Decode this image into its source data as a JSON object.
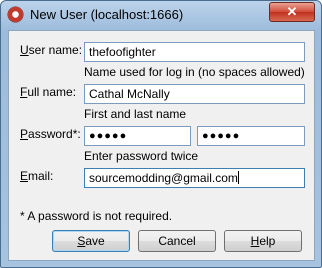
{
  "window": {
    "title": "New User (localhost:1666)",
    "close_glyph": "✕"
  },
  "form": {
    "user_name": {
      "label": "User name:",
      "mnemonic": "U",
      "label_rest": "ser name:",
      "value": "thefoofighter",
      "hint": "Name used for log in (no spaces allowed)"
    },
    "full_name": {
      "label": "Full name:",
      "mnemonic": "F",
      "label_rest": "ull name:",
      "value": "Cathal McNally",
      "hint": "First and last name"
    },
    "password": {
      "label": "Password*:",
      "mnemonic": "P",
      "label_rest": "assword*:",
      "value_masked": "●●●●●",
      "confirm_masked": "●●●●●",
      "hint": "Enter password twice"
    },
    "email": {
      "label": "Email:",
      "mnemonic": "E",
      "label_rest": "mail:",
      "value": "sourcemodding@gmail.com"
    },
    "note": "* A password is not required."
  },
  "buttons": {
    "save": {
      "mnemonic": "S",
      "rest": "ave"
    },
    "cancel": {
      "label": "Cancel"
    },
    "help": {
      "mnemonic": "H",
      "rest": "elp"
    }
  },
  "icons": {
    "app": "p4-app-icon",
    "close": "close-icon"
  }
}
